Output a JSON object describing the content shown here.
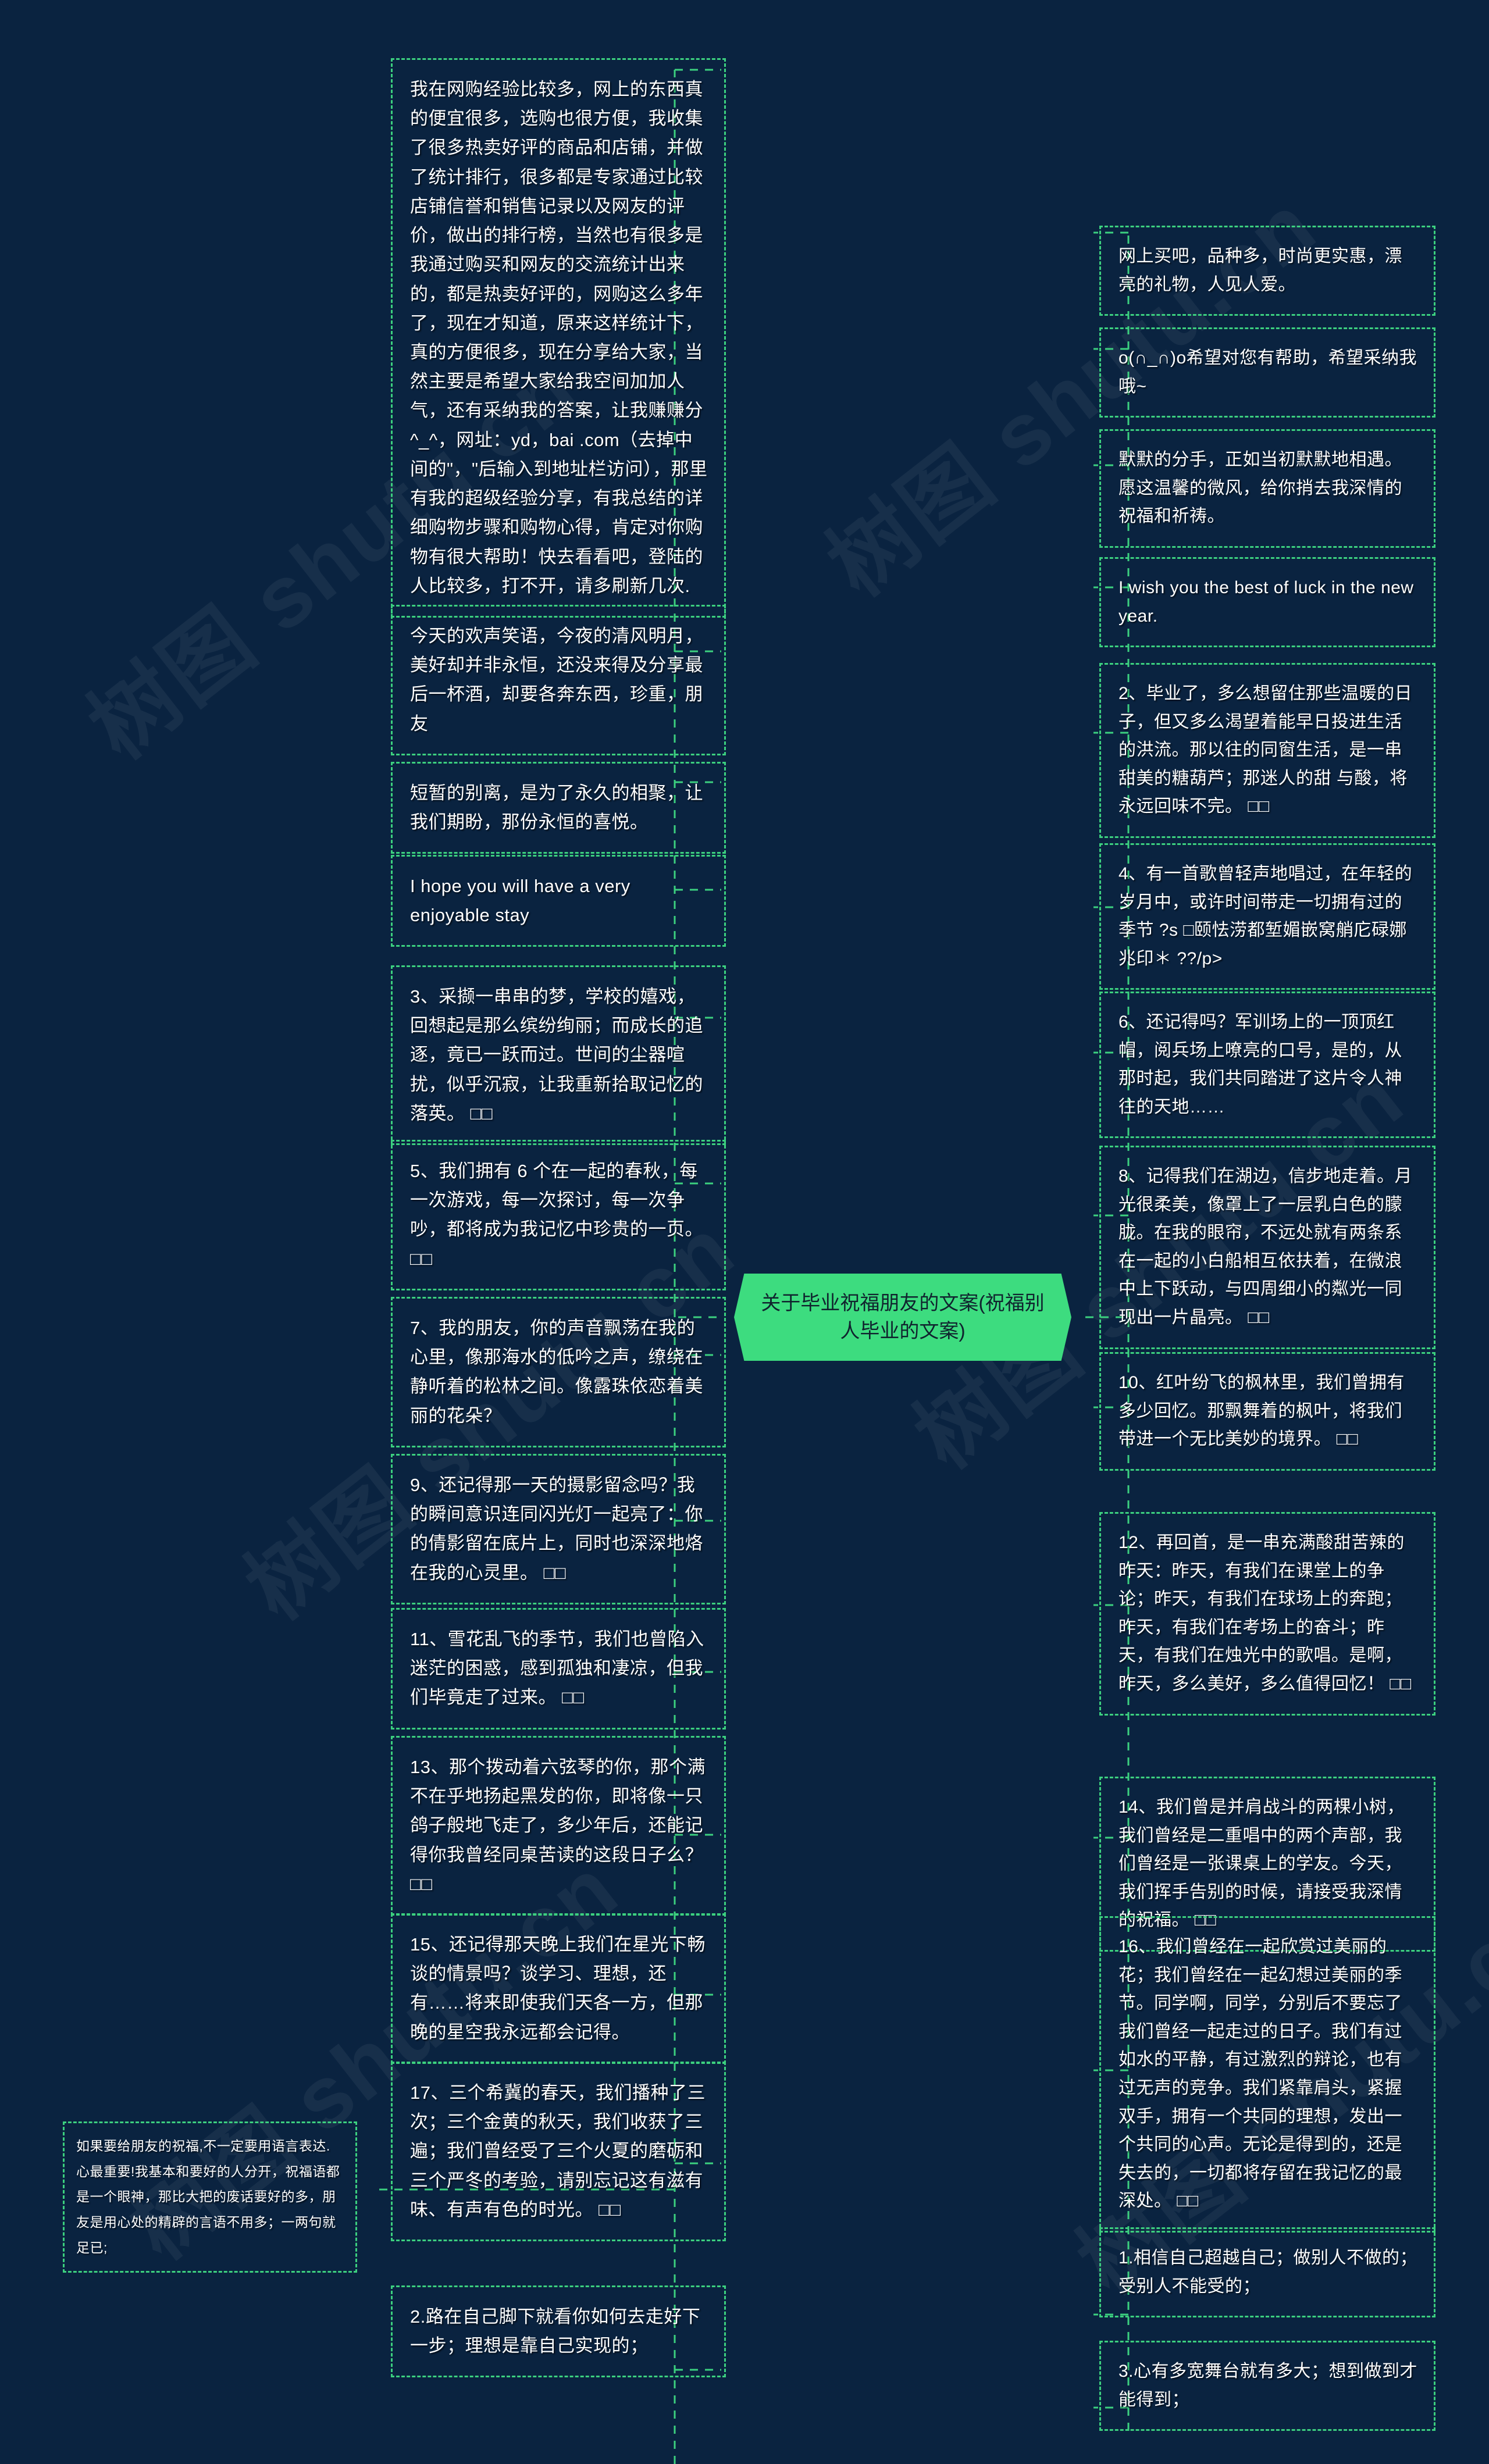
{
  "meta": {
    "bg_color": "#0a2340",
    "accent_color": "#3cd07f",
    "title_badge_color": "#3ddc7f",
    "text_color": "#ffffff"
  },
  "title": {
    "text": "关于毕业祝福朋友的文案(祝福别人毕业的文案)"
  },
  "watermarks": [
    "树图 shutu.cn",
    "树图 shutu.cn",
    "树图 shutu.cn",
    "树图 shutu.cn",
    "树图 shutu.cn",
    "树图 shutu.cn"
  ],
  "left_column": [
    {
      "id": "L1",
      "text": "我在网购经验比较多，网上的东西真的便宜很多，选购也很方便，我收集了很多热卖好评的商品和店铺，并做了统计排行，很多都是专家通过比较店铺信誉和销售记录以及网友的评价，做出的排行榜，当然也有很多是我通过购买和网友的交流统计出来的，都是热卖好评的，网购这么多年了，现在才知道，原来这样统计下，真的方便很多，现在分享给大家，当然主要是希望大家给我空间加加人气，还有采纳我的答案，让我赚赚分^_^，网址：yd，bai .com（去掉中间的\"，\"后输入到地址栏访问），那里有我的超级经验分享，有我总结的详细购物步骤和购物心得，肯定对你购物有很大帮助！快去看看吧，登陆的人比较多，打不开，请多刷新几次."
    },
    {
      "id": "L2",
      "text": "今天的欢声笑语，今夜的清风明月，美好却并非永恒，还没来得及分享最后一杯酒，却要各奔东西，珍重，朋友"
    },
    {
      "id": "L3",
      "text": "短暂的别离，是为了永久的相聚，让我们期盼，那份永恒的喜悦。"
    },
    {
      "id": "L4",
      "text": "I hope you will have a very enjoyable stay"
    },
    {
      "id": "L5",
      "text": "3、采撷一串串的梦，学校的嬉戏，回想起是那么缤纷绚丽；而成长的追逐，竟已一跃而过。世间的尘器喧扰，似乎沉寂，让我重新拾取记忆的落英。 □□"
    },
    {
      "id": "L6",
      "text": "5、我们拥有 6 个在一起的春秋，每一次游戏，每一次探讨，每一次争吵，都将成为我记忆中珍贵的一页。 □□"
    },
    {
      "id": "L7",
      "text": "7、我的朋友，你的声音飘荡在我的心里，像那海水的低吟之声，缭绕在静听着的松林之间。像露珠依恋着美丽的花朵？"
    },
    {
      "id": "L8",
      "text": "9、还记得那一天的摄影留念吗？我的瞬间意识连同闪光灯一起亮了：你的倩影留在底片上，同时也深深地烙在我的心灵里。 □□"
    },
    {
      "id": "L9",
      "text": "11、雪花乱飞的季节，我们也曾陷入迷茫的困惑，感到孤独和凄凉，但我们毕竟走了过来。 □□"
    },
    {
      "id": "L10",
      "text": "13、那个拨动着六弦琴的你，那个满不在乎地扬起黑发的你，即将像一只鸽子般地飞走了，多少年后，还能记得你我曾经同桌苦读的这段日子么？ □□"
    },
    {
      "id": "L11",
      "text": "15、还记得那天晚上我们在星光下畅谈的情景吗？谈学习、理想，还有……将来即使我们天各一方，但那晚的星空我永远都会记得。"
    },
    {
      "id": "L12",
      "text": "17、三个希冀的春天，我们播种了三次；三个金黄的秋天，我们收获了三遍；我们曾经受了三个火夏的磨砺和三个严冬的考验，请别忘记这有滋有味、有声有色的时光。 □□"
    },
    {
      "id": "L13",
      "text": "2.路在自己脚下就看你如何去走好下一步；理想是靠自己实现的；"
    }
  ],
  "far_left": [
    {
      "id": "F1",
      "text": "如果要给朋友的祝福,不一定要用语言表达.心最重要!我基本和要好的人分开，祝福语都是一个眼神，那比大把的废话要好的多，朋友是用心处的精辟的言语不用多；一两句就足已;"
    }
  ],
  "right_column": [
    {
      "id": "R1",
      "text": "网上买吧，品种多，时尚更实惠，漂亮的礼物，人见人爱。"
    },
    {
      "id": "R2",
      "text": "o(∩_∩)o希望对您有帮助，希望采纳我哦~"
    },
    {
      "id": "R3",
      "text": "默默的分手，正如当初默默地相遇。愿这温馨的微风，给你捎去我深情的祝福和祈祷。"
    },
    {
      "id": "R4",
      "text": "I wish you the best of luck in the new year."
    },
    {
      "id": "R5",
      "text": "2、毕业了，多么想留住那些温暖的日子，但又多么渴望着能早日投进生活的洪流。那以往的同窗生活，是一串甜美的糖葫芦；那迷人的甜 与酸，将永远回味不完。 □□"
    },
    {
      "id": "R6",
      "text": "4、有一首歌曾轻声地唱过，在年轻的岁月中，或许时间带走一切拥有过的季节 ?s □颐怯涝都堑媚嵌窝艄庀碌娜兆印＊ ??/p>"
    },
    {
      "id": "R7",
      "text": "6、还记得吗？军训场上的一顶顶红帽，阅兵场上嘹亮的口号，是的，从那时起，我们共同踏进了这片令人神往的天地……"
    },
    {
      "id": "R8",
      "text": "8、记得我们在湖边，信步地走着。月光很柔美，像罩上了一层乳白色的朦胧。在我的眼帘，不远处就有两条系在一起的小白船相互依扶着，在微浪中上下跃动，与四周细小的粼光一同现出一片晶亮。 □□"
    },
    {
      "id": "R9",
      "text": "10、红叶纷飞的枫林里，我们曾拥有多少回忆。那飘舞着的枫叶，将我们带进一个无比美妙的境界。 □□"
    },
    {
      "id": "R10",
      "text": "12、再回首，是一串充满酸甜苦辣的昨天：昨天，有我们在课堂上的争论；昨天，有我们在球场上的奔跑；昨天，有我们在考场上的奋斗；昨天，有我们在烛光中的歌唱。是啊，昨天，多么美好，多么值得回忆！ □□"
    },
    {
      "id": "R11",
      "text": "14、我们曾是并肩战斗的两棵小树，我们曾经是二重唱中的两个声部，我们曾经是一张课桌上的学友。今天，我们挥手告别的时候，请接受我深情的祝福。 □□"
    },
    {
      "id": "R12",
      "text": "16、我们曾经在一起欣赏过美丽的花；我们曾经在一起幻想过美丽的季节。同学啊，同学，分别后不要忘了我们曾经一起走过的日子。我们有过如水的平静，有过激烈的辩论，也有过无声的竞争。我们紧靠肩头，紧握双手，拥有一个共同的理想，发出一个共同的心声。无论是得到的，还是失去的，一切都将存留在我记忆的最深处。 □□"
    },
    {
      "id": "R13",
      "text": "1.相信自己超越自己；做别人不做的；受别人不能受的；"
    },
    {
      "id": "R14",
      "text": "3.心有多宽舞台就有多大；想到做到才能得到；"
    }
  ]
}
